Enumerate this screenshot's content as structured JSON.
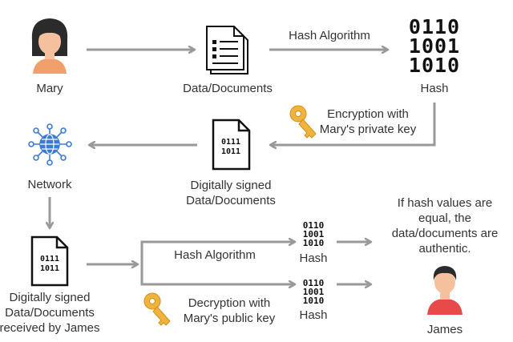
{
  "diagram": {
    "nodes": {
      "mary": {
        "label": "Mary"
      },
      "data_docs": {
        "label": "Data/Documents"
      },
      "hash_top": {
        "label": "Hash",
        "bits": [
          "0110",
          "1001",
          "1010"
        ]
      },
      "encryption": {
        "label_line1": "Encryption with",
        "label_line2": "Mary's private key"
      },
      "signed_docs": {
        "label_line1": "Digitally signed",
        "label_line2": "Data/Documents",
        "bits": [
          "0111",
          "1011"
        ]
      },
      "network": {
        "label": "Network"
      },
      "received_docs": {
        "label_line1": "Digitally signed",
        "label_line2": "Data/Documents",
        "label_line3": "received by James",
        "bits": [
          "0111",
          "1011"
        ]
      },
      "hash_a": {
        "label": "Hash",
        "bits": [
          "0110",
          "1001",
          "1010"
        ]
      },
      "hash_b": {
        "label": "Hash",
        "bits": [
          "0110",
          "1001",
          "1010"
        ]
      },
      "decryption": {
        "label_line1": "Decryption with",
        "label_line2": "Mary's public key"
      },
      "james": {
        "label": "James"
      },
      "result_note": {
        "line1": "If hash values are",
        "line2": "equal, the",
        "line3": "data/documents are",
        "line4": "authentic."
      }
    },
    "edges": {
      "hash_algorithm_top": "Hash Algorithm",
      "hash_algorithm_bottom": "Hash Algorithm"
    },
    "colors": {
      "arrow": "#999999",
      "skin": "#f5c09e",
      "mary_hair": "#2b2b2b",
      "mary_shirt": "#f2a06b",
      "james_shirt": "#e84a4a",
      "key": "#f2b33d",
      "globe": "#3a7bd5"
    }
  }
}
